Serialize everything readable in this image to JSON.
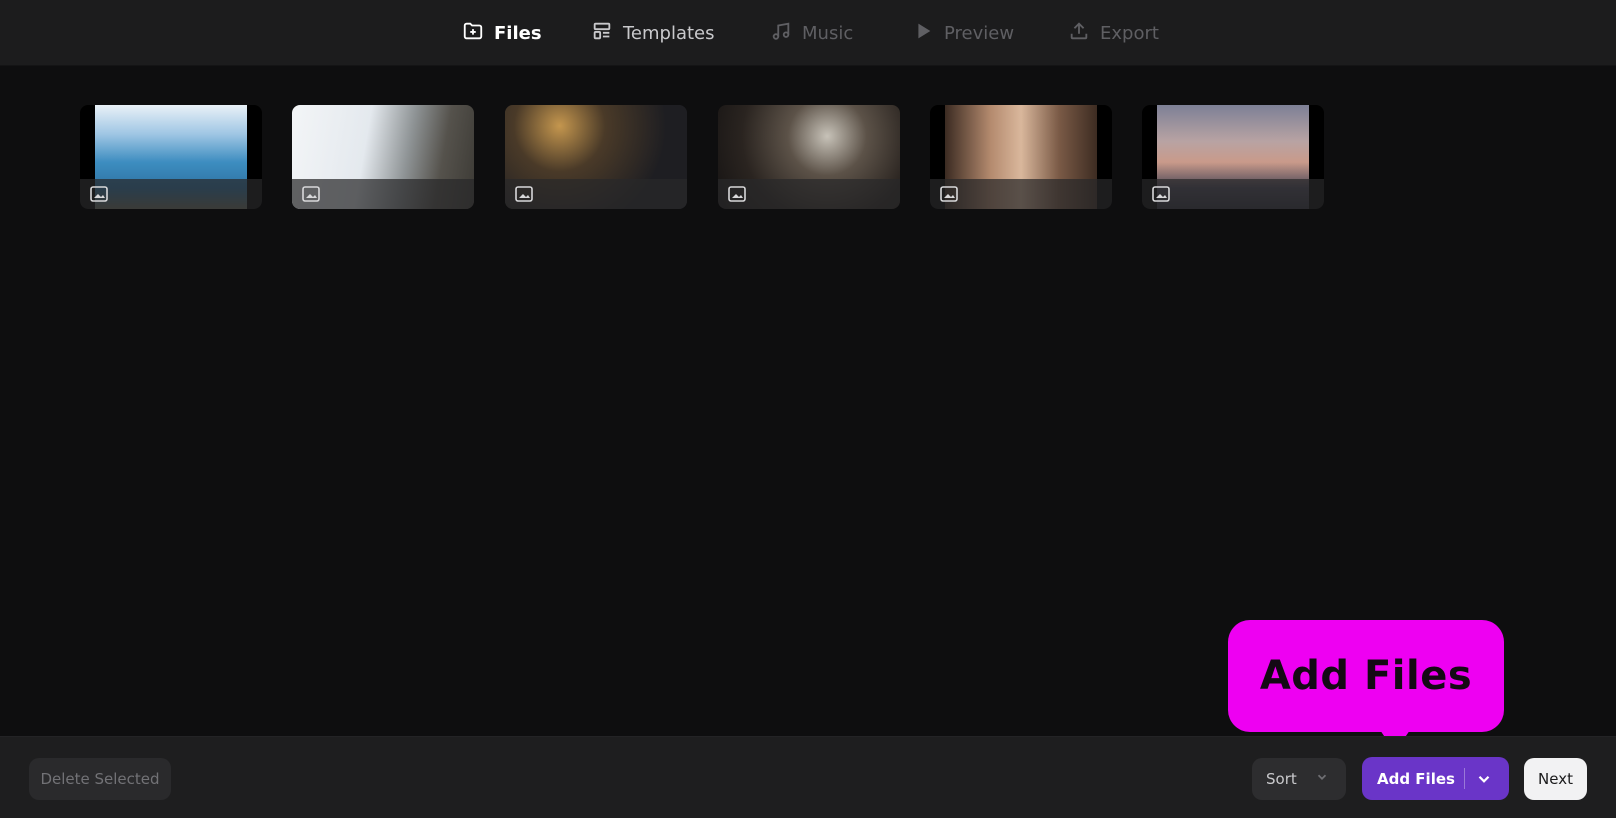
{
  "nav": {
    "tabs": [
      {
        "label": "Files",
        "icon": "folder-plus-icon",
        "state": "active"
      },
      {
        "label": "Templates",
        "icon": "template-icon",
        "state": "normal"
      },
      {
        "label": "Music",
        "icon": "music-note-icon",
        "state": "disabled"
      },
      {
        "label": "Preview",
        "icon": "play-icon",
        "state": "disabled"
      },
      {
        "label": "Export",
        "icon": "upload-icon",
        "state": "disabled"
      }
    ]
  },
  "thumbnails": [
    {
      "type": "image",
      "badge": "image-icon"
    },
    {
      "type": "image",
      "badge": "image-icon"
    },
    {
      "type": "image",
      "badge": "image-icon"
    },
    {
      "type": "image",
      "badge": "image-icon"
    },
    {
      "type": "image",
      "badge": "image-icon"
    },
    {
      "type": "image",
      "badge": "image-icon"
    }
  ],
  "footer": {
    "delete_label": "Delete Selected",
    "sort_label": "Sort",
    "add_files_label": "Add Files",
    "next_label": "Next"
  },
  "callout": {
    "text": "Add Files"
  },
  "colors": {
    "accent": "#6a35c8",
    "callout": "#ee00f2",
    "background": "#0e0e0f",
    "bar": "#1c1c1d"
  }
}
